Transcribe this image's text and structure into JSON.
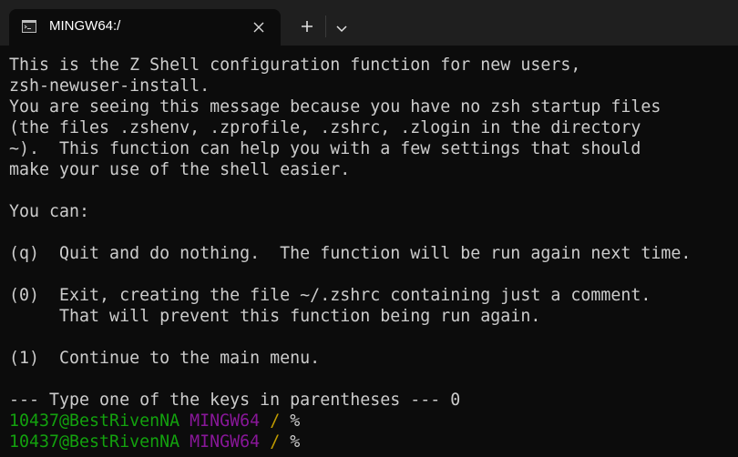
{
  "window": {
    "tab_title": "MINGW64:/",
    "tab_icon": "terminal-icon",
    "close_icon": "close-icon",
    "new_tab_icon": "plus-icon",
    "dropdown_icon": "chevron-down-icon"
  },
  "colors": {
    "background": "#0c0c0c",
    "titlebar": "#1f1f1f",
    "text": "#cccccc",
    "prompt_user": "#13a10e",
    "prompt_env": "#881798",
    "prompt_path": "#c19c00"
  },
  "output": {
    "lines": [
      "This is the Z Shell configuration function for new users,",
      "zsh-newuser-install.",
      "You are seeing this message because you have no zsh startup files",
      "(the files .zshenv, .zprofile, .zshrc, .zlogin in the directory",
      "~).  This function can help you with a few settings that should",
      "make your use of the shell easier.",
      "",
      "You can:",
      "",
      "(q)  Quit and do nothing.  The function will be run again next time.",
      "",
      "(0)  Exit, creating the file ~/.zshrc containing just a comment.",
      "     That will prevent this function being run again.",
      "",
      "(1)  Continue to the main menu.",
      "",
      "--- Type one of the keys in parentheses --- 0"
    ]
  },
  "prompts": [
    {
      "user_host": "10437@BestRivenNA",
      "env": "MINGW64",
      "path": "/",
      "symbol": "%"
    },
    {
      "user_host": "10437@BestRivenNA",
      "env": "MINGW64",
      "path": "/",
      "symbol": "%"
    }
  ]
}
